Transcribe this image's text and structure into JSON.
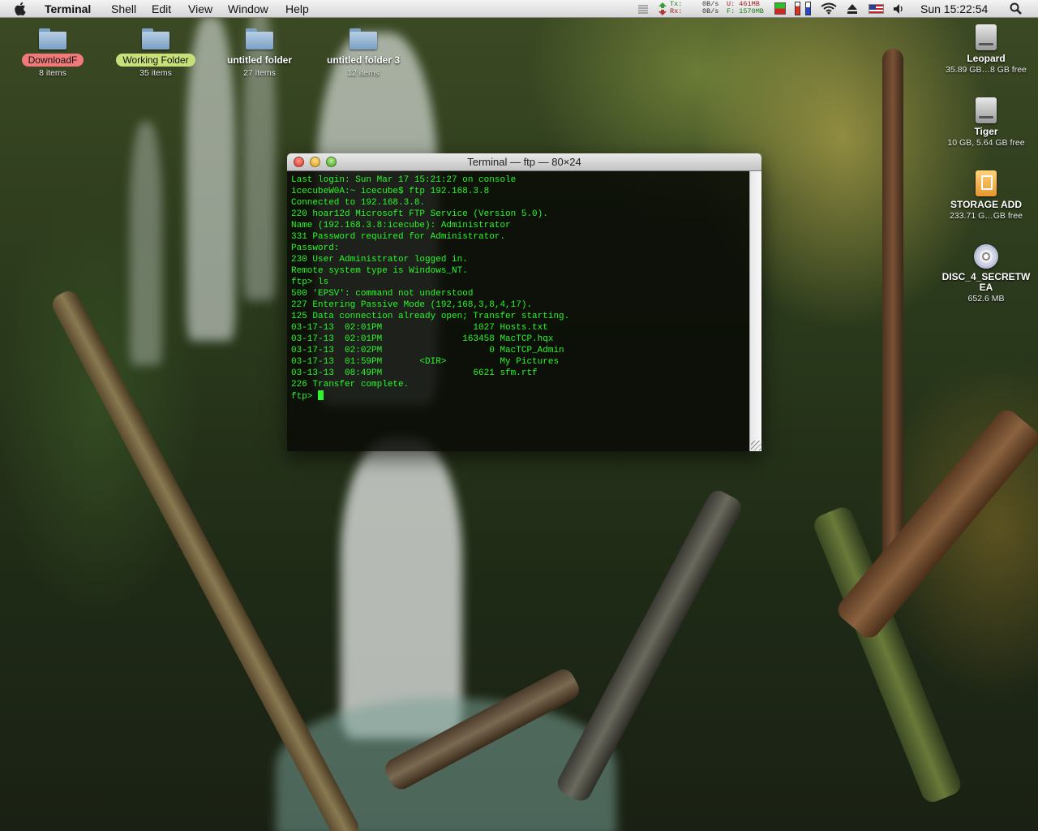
{
  "menubar": {
    "app_name": "Terminal",
    "menus": [
      "Shell",
      "Edit",
      "View",
      "Window",
      "Help"
    ],
    "net_tx_label": "Tx:",
    "net_rx_label": "Rx:",
    "net_tx": "0B/s",
    "net_rx": "0B/s",
    "mem_used": "U: 461MB",
    "mem_free": "F: 1570MB",
    "clock": "Sun 15:22:54"
  },
  "desktop_left": [
    {
      "name": "DownloadF",
      "sub": "8 items",
      "tag": "red"
    },
    {
      "name": "Working Folder",
      "sub": "35 items",
      "tag": "green"
    },
    {
      "name": "untitled folder",
      "sub": "27 items",
      "tag": "none"
    },
    {
      "name": "untitled folder 3",
      "sub": "12 items",
      "tag": "none"
    }
  ],
  "desktop_right": [
    {
      "name": "Leopard",
      "sub": "35.89 GB…8 GB free",
      "kind": "drive"
    },
    {
      "name": "Tiger",
      "sub": "10 GB, 5.64 GB free",
      "kind": "drive"
    },
    {
      "name": "STORAGE ADD",
      "sub": "233.71 G…GB free",
      "kind": "storage"
    },
    {
      "name": "DISC_4_SECRETW EA",
      "sub": "652.6 MB",
      "kind": "disc"
    }
  ],
  "terminal": {
    "title": "Terminal — ftp — 80×24",
    "lines": [
      "Last login: Sun Mar 17 15:21:27 on console",
      "icecubeW0A:~ icecube$ ftp 192.168.3.8",
      "Connected to 192.168.3.8.",
      "220 hoar12d Microsoft FTP Service (Version 5.0).",
      "Name (192.168.3.8:icecube): Administrator",
      "331 Password required for Administrator.",
      "Password:",
      "230 User Administrator logged in.",
      "Remote system type is Windows_NT.",
      "ftp> ls",
      "500 'EPSV': command not understood",
      "227 Entering Passive Mode (192,168,3,8,4,17).",
      "125 Data connection already open; Transfer starting.",
      "03-17-13  02:01PM                 1027 Hosts.txt",
      "03-17-13  02:01PM               163458 MacTCP.hqx",
      "03-17-13  02:02PM                    0 MacTCP_Admin",
      "03-17-13  01:59PM       <DIR>          My Pictures",
      "03-13-13  08:49PM                 6621 sfm.rtf",
      "226 Transfer complete."
    ],
    "prompt": "ftp> ",
    "text_color": "#2cf52c"
  }
}
